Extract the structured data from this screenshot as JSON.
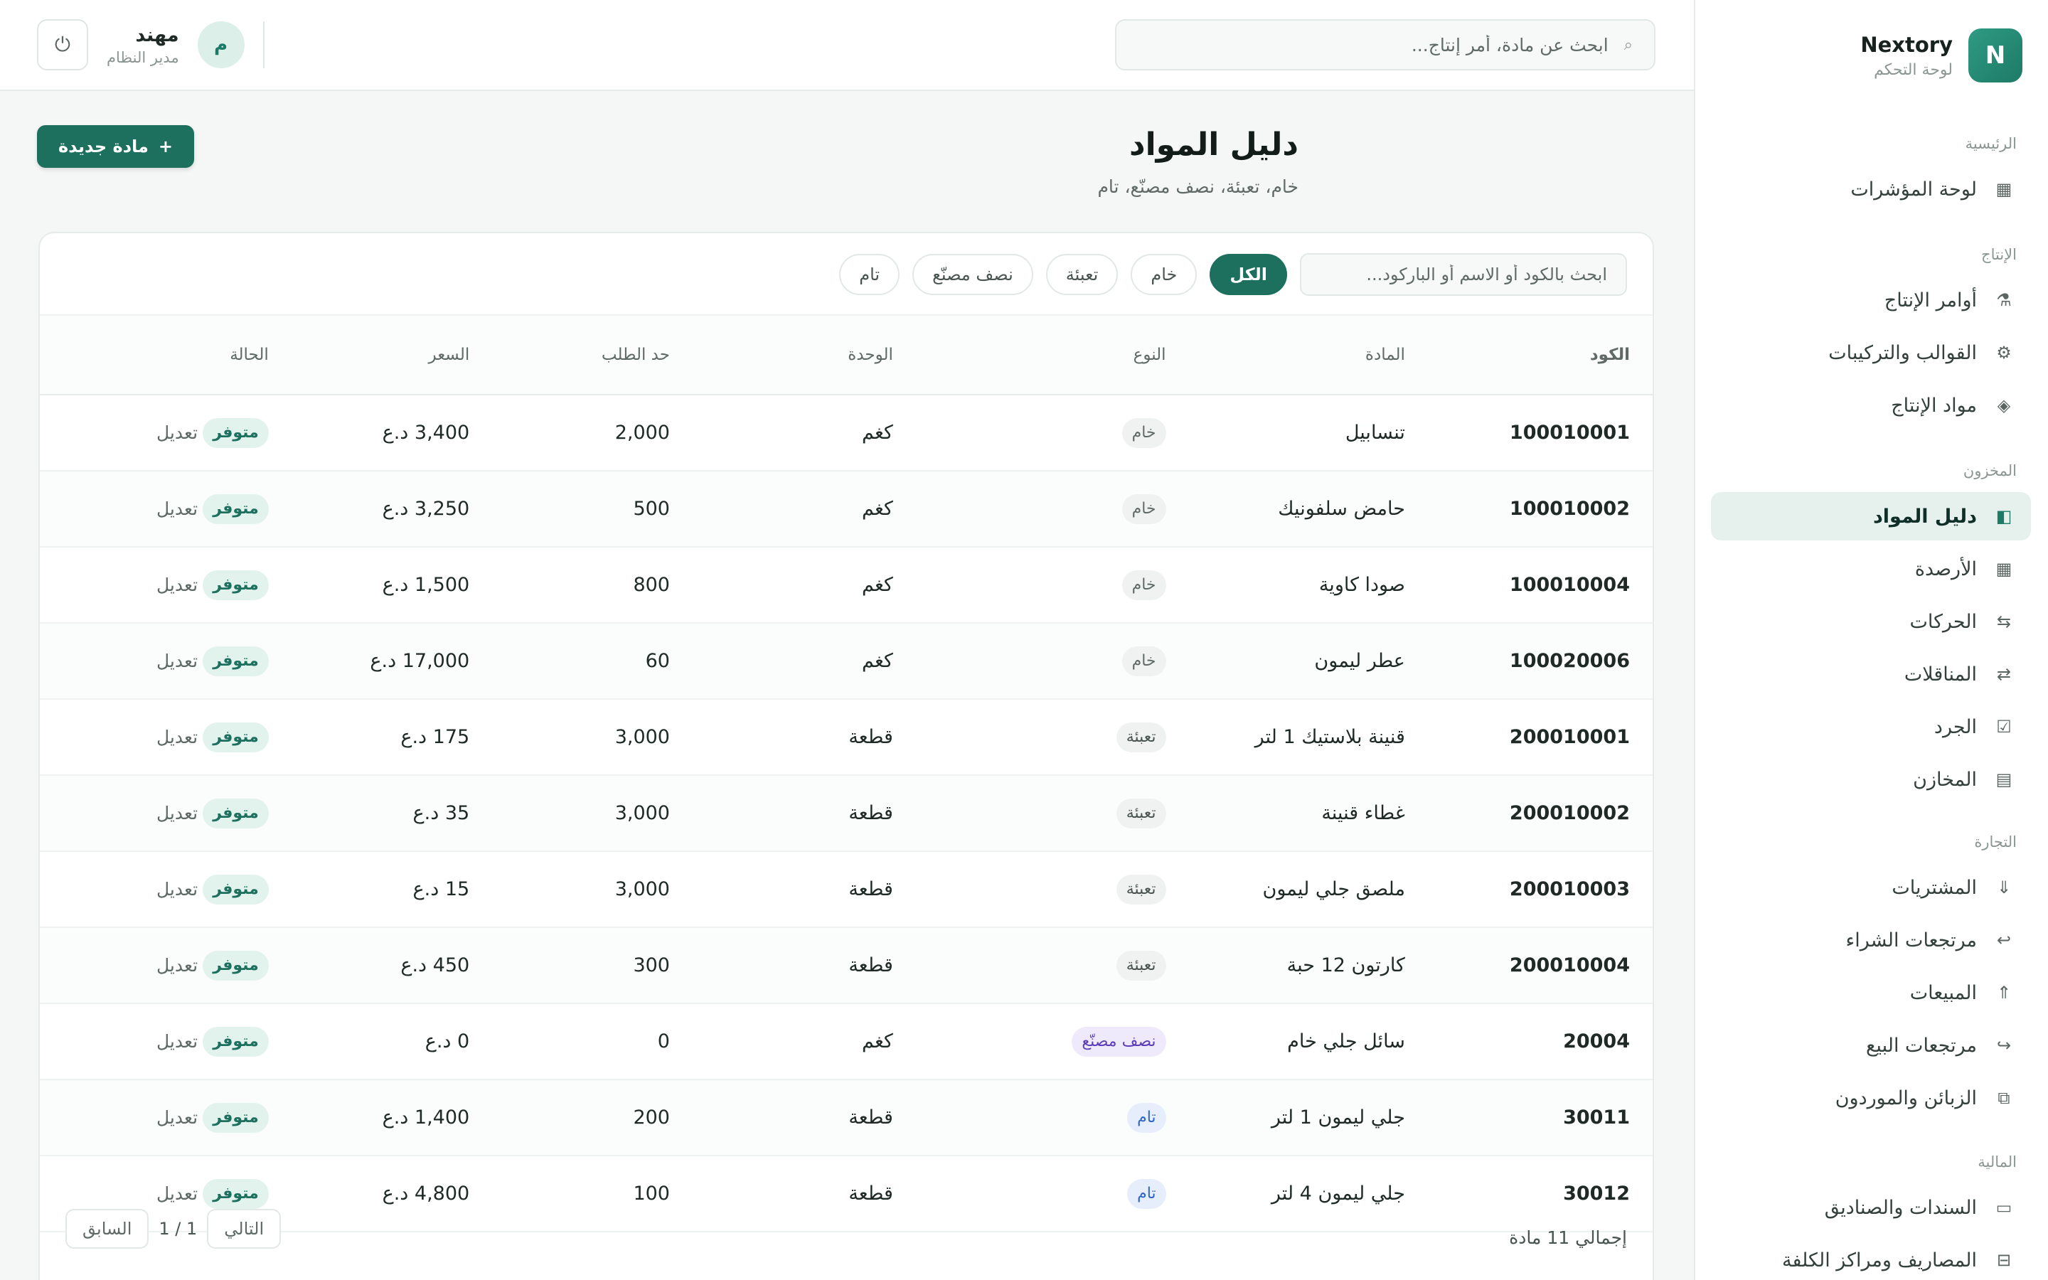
{
  "brand": {
    "logo_letter": "N",
    "name": "Nextory",
    "subtitle": "لوحة التحكم"
  },
  "nav": {
    "sections": [
      {
        "title": "الرئيسية",
        "items": [
          {
            "label": "لوحة المؤشرات",
            "icon": "grid-icon"
          }
        ]
      },
      {
        "title": "الإنتاج",
        "items": [
          {
            "label": "أوامر الإنتاج",
            "icon": "factory-icon"
          },
          {
            "label": "القوالب والتركيبات",
            "icon": "gear-icon"
          },
          {
            "label": "مواد الإنتاج",
            "icon": "diamond-icon"
          }
        ]
      },
      {
        "title": "المخزون",
        "items": [
          {
            "label": "دليل المواد",
            "icon": "book-icon",
            "active": true
          },
          {
            "label": "الأرصدة",
            "icon": "grid-icon"
          },
          {
            "label": "الحركات",
            "icon": "movements-icon"
          },
          {
            "label": "المناقلات",
            "icon": "transfer-icon"
          },
          {
            "label": "الجرد",
            "icon": "checkbox-icon"
          },
          {
            "label": "المخازن",
            "icon": "warehouse-icon"
          }
        ]
      },
      {
        "title": "التجارة",
        "items": [
          {
            "label": "المشتريات",
            "icon": "arrow-down-icon"
          },
          {
            "label": "مرتجعات الشراء",
            "icon": "return-icon"
          },
          {
            "label": "المبيعات",
            "icon": "arrow-up-icon"
          },
          {
            "label": "مرتجعات البيع",
            "icon": "return-icon"
          },
          {
            "label": "الزبائن والموردون",
            "icon": "users-icon"
          }
        ]
      },
      {
        "title": "المالية",
        "items": [
          {
            "label": "السندات والصناديق",
            "icon": "cash-icon"
          },
          {
            "label": "المصاريف ومراكز الكلفة",
            "icon": "expense-icon"
          }
        ]
      }
    ]
  },
  "topbar": {
    "search_placeholder": "ابحث عن مادة، أمر إنتاج...",
    "user": {
      "avatar_letter": "م",
      "name": "مهند",
      "role": "مدير النظام"
    }
  },
  "page": {
    "title": "دليل المواد",
    "subtitle": "خام، تعبئة، نصف مصنّع، تام",
    "new_button": "مادة جديدة",
    "new_button_icon": "+"
  },
  "filters": {
    "search_placeholder": "ابحث بالكود أو الاسم أو الباركود...",
    "chips": [
      "الكل",
      "خام",
      "تعبئة",
      "نصف مصنّع",
      "تام"
    ],
    "active": "الكل"
  },
  "table": {
    "columns": [
      "الكود",
      "المادة",
      "النوع",
      "الوحدة",
      "حد الطلب",
      "السعر",
      "الحالة"
    ],
    "rows": [
      {
        "code": "100010001",
        "name": "تنسابيل",
        "type": "خام",
        "type_kind": "raw",
        "unit": "كغم",
        "reorder": "2,000",
        "price": "3,400 د.ع",
        "status": "متوفر",
        "action": "تعديل"
      },
      {
        "code": "100010002",
        "name": "حامض سلفونيك",
        "type": "خام",
        "type_kind": "raw",
        "unit": "كغم",
        "reorder": "500",
        "price": "3,250 د.ع",
        "status": "متوفر",
        "action": "تعديل"
      },
      {
        "code": "100010004",
        "name": "صودا كاوية",
        "type": "خام",
        "type_kind": "raw",
        "unit": "كغم",
        "reorder": "800",
        "price": "1,500 د.ع",
        "status": "متوفر",
        "action": "تعديل"
      },
      {
        "code": "100020006",
        "name": "عطر ليمون",
        "type": "خام",
        "type_kind": "raw",
        "unit": "كغم",
        "reorder": "60",
        "price": "17,000 د.ع",
        "status": "متوفر",
        "action": "تعديل"
      },
      {
        "code": "200010001",
        "name": "قنينة بلاستيك 1 لتر",
        "type": "تعبئة",
        "type_kind": "pack",
        "unit": "قطعة",
        "reorder": "3,000",
        "price": "175 د.ع",
        "status": "متوفر",
        "action": "تعديل"
      },
      {
        "code": "200010002",
        "name": "غطاء قنينة",
        "type": "تعبئة",
        "type_kind": "pack",
        "unit": "قطعة",
        "reorder": "3,000",
        "price": "35 د.ع",
        "status": "متوفر",
        "action": "تعديل"
      },
      {
        "code": "200010003",
        "name": "ملصق جلي ليمون",
        "type": "تعبئة",
        "type_kind": "pack",
        "unit": "قطعة",
        "reorder": "3,000",
        "price": "15 د.ع",
        "status": "متوفر",
        "action": "تعديل"
      },
      {
        "code": "200010004",
        "name": "كارتون 12 حبة",
        "type": "تعبئة",
        "type_kind": "pack",
        "unit": "قطعة",
        "reorder": "300",
        "price": "450 د.ع",
        "status": "متوفر",
        "action": "تعديل"
      },
      {
        "code": "20004",
        "name": "سائل جلي خام",
        "type": "نصف مصنّع",
        "type_kind": "semi",
        "unit": "كغم",
        "reorder": "0",
        "price": "0 د.ع",
        "status": "متوفر",
        "action": "تعديل"
      },
      {
        "code": "30011",
        "name": "جلي ليمون 1 لتر",
        "type": "تام",
        "type_kind": "done",
        "unit": "قطعة",
        "reorder": "200",
        "price": "1,400 د.ع",
        "status": "متوفر",
        "action": "تعديل"
      },
      {
        "code": "30012",
        "name": "جلي ليمون 4 لتر",
        "type": "تام",
        "type_kind": "done",
        "unit": "قطعة",
        "reorder": "100",
        "price": "4,800 د.ع",
        "status": "متوفر",
        "action": "تعديل"
      }
    ]
  },
  "footer": {
    "total": "إجمالي 11 مادة",
    "prev": "السابق",
    "next": "التالي",
    "page_indicator": "1 / 1"
  },
  "colors": {
    "accent": "#1d6f5e",
    "active_nav_bg": "#e6f1ee",
    "available_badge": "#e2f2ec",
    "semi_badge": "#efeafb",
    "done_badge": "#e6eefb"
  }
}
